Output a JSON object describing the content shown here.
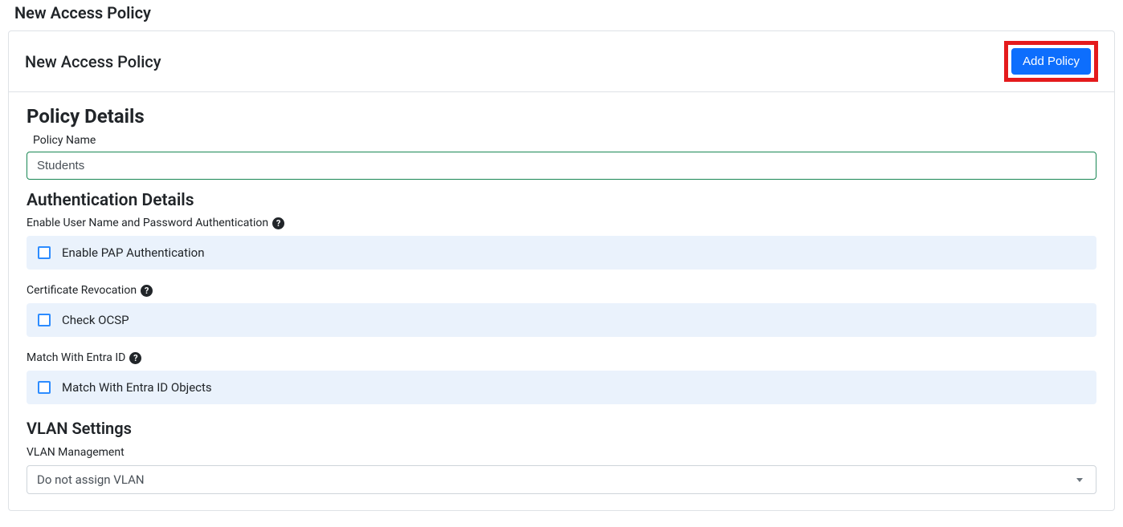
{
  "pageTitle": "New Access Policy",
  "header": {
    "title": "New Access Policy",
    "addButton": "Add Policy"
  },
  "policyDetails": {
    "sectionTitle": "Policy Details",
    "nameLabel": "Policy Name",
    "nameValue": "Students"
  },
  "authDetails": {
    "sectionTitle": "Authentication Details",
    "enableUserPassLabel": "Enable User Name and Password Authentication",
    "enablePapLabel": "Enable PAP Authentication",
    "certRevocationLabel": "Certificate Revocation",
    "checkOcspLabel": "Check OCSP",
    "matchEntraLabel": "Match With Entra ID",
    "matchEntraObjectsLabel": "Match With Entra ID Objects"
  },
  "vlan": {
    "sectionTitle": "VLAN Settings",
    "managementLabel": "VLAN Management",
    "selectedValue": "Do not assign VLAN"
  },
  "icons": {
    "helpText": "?"
  }
}
